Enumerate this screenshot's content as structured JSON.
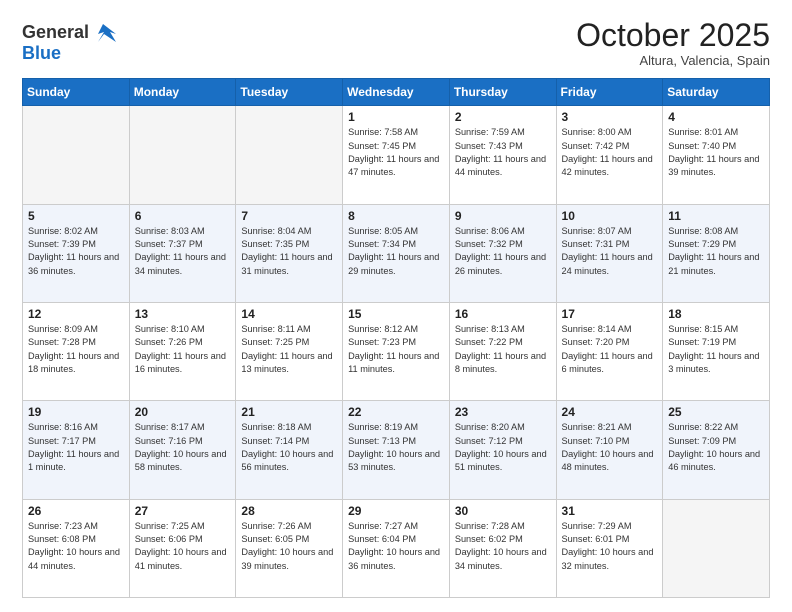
{
  "header": {
    "logo_general": "General",
    "logo_blue": "Blue",
    "month_title": "October 2025",
    "subtitle": "Altura, Valencia, Spain"
  },
  "weekdays": [
    "Sunday",
    "Monday",
    "Tuesday",
    "Wednesday",
    "Thursday",
    "Friday",
    "Saturday"
  ],
  "weeks": [
    [
      {
        "day": "",
        "info": ""
      },
      {
        "day": "",
        "info": ""
      },
      {
        "day": "",
        "info": ""
      },
      {
        "day": "1",
        "info": "Sunrise: 7:58 AM\nSunset: 7:45 PM\nDaylight: 11 hours\nand 47 minutes."
      },
      {
        "day": "2",
        "info": "Sunrise: 7:59 AM\nSunset: 7:43 PM\nDaylight: 11 hours\nand 44 minutes."
      },
      {
        "day": "3",
        "info": "Sunrise: 8:00 AM\nSunset: 7:42 PM\nDaylight: 11 hours\nand 42 minutes."
      },
      {
        "day": "4",
        "info": "Sunrise: 8:01 AM\nSunset: 7:40 PM\nDaylight: 11 hours\nand 39 minutes."
      }
    ],
    [
      {
        "day": "5",
        "info": "Sunrise: 8:02 AM\nSunset: 7:39 PM\nDaylight: 11 hours\nand 36 minutes."
      },
      {
        "day": "6",
        "info": "Sunrise: 8:03 AM\nSunset: 7:37 PM\nDaylight: 11 hours\nand 34 minutes."
      },
      {
        "day": "7",
        "info": "Sunrise: 8:04 AM\nSunset: 7:35 PM\nDaylight: 11 hours\nand 31 minutes."
      },
      {
        "day": "8",
        "info": "Sunrise: 8:05 AM\nSunset: 7:34 PM\nDaylight: 11 hours\nand 29 minutes."
      },
      {
        "day": "9",
        "info": "Sunrise: 8:06 AM\nSunset: 7:32 PM\nDaylight: 11 hours\nand 26 minutes."
      },
      {
        "day": "10",
        "info": "Sunrise: 8:07 AM\nSunset: 7:31 PM\nDaylight: 11 hours\nand 24 minutes."
      },
      {
        "day": "11",
        "info": "Sunrise: 8:08 AM\nSunset: 7:29 PM\nDaylight: 11 hours\nand 21 minutes."
      }
    ],
    [
      {
        "day": "12",
        "info": "Sunrise: 8:09 AM\nSunset: 7:28 PM\nDaylight: 11 hours\nand 18 minutes."
      },
      {
        "day": "13",
        "info": "Sunrise: 8:10 AM\nSunset: 7:26 PM\nDaylight: 11 hours\nand 16 minutes."
      },
      {
        "day": "14",
        "info": "Sunrise: 8:11 AM\nSunset: 7:25 PM\nDaylight: 11 hours\nand 13 minutes."
      },
      {
        "day": "15",
        "info": "Sunrise: 8:12 AM\nSunset: 7:23 PM\nDaylight: 11 hours\nand 11 minutes."
      },
      {
        "day": "16",
        "info": "Sunrise: 8:13 AM\nSunset: 7:22 PM\nDaylight: 11 hours\nand 8 minutes."
      },
      {
        "day": "17",
        "info": "Sunrise: 8:14 AM\nSunset: 7:20 PM\nDaylight: 11 hours\nand 6 minutes."
      },
      {
        "day": "18",
        "info": "Sunrise: 8:15 AM\nSunset: 7:19 PM\nDaylight: 11 hours\nand 3 minutes."
      }
    ],
    [
      {
        "day": "19",
        "info": "Sunrise: 8:16 AM\nSunset: 7:17 PM\nDaylight: 11 hours\nand 1 minute."
      },
      {
        "day": "20",
        "info": "Sunrise: 8:17 AM\nSunset: 7:16 PM\nDaylight: 10 hours\nand 58 minutes."
      },
      {
        "day": "21",
        "info": "Sunrise: 8:18 AM\nSunset: 7:14 PM\nDaylight: 10 hours\nand 56 minutes."
      },
      {
        "day": "22",
        "info": "Sunrise: 8:19 AM\nSunset: 7:13 PM\nDaylight: 10 hours\nand 53 minutes."
      },
      {
        "day": "23",
        "info": "Sunrise: 8:20 AM\nSunset: 7:12 PM\nDaylight: 10 hours\nand 51 minutes."
      },
      {
        "day": "24",
        "info": "Sunrise: 8:21 AM\nSunset: 7:10 PM\nDaylight: 10 hours\nand 48 minutes."
      },
      {
        "day": "25",
        "info": "Sunrise: 8:22 AM\nSunset: 7:09 PM\nDaylight: 10 hours\nand 46 minutes."
      }
    ],
    [
      {
        "day": "26",
        "info": "Sunrise: 7:23 AM\nSunset: 6:08 PM\nDaylight: 10 hours\nand 44 minutes."
      },
      {
        "day": "27",
        "info": "Sunrise: 7:25 AM\nSunset: 6:06 PM\nDaylight: 10 hours\nand 41 minutes."
      },
      {
        "day": "28",
        "info": "Sunrise: 7:26 AM\nSunset: 6:05 PM\nDaylight: 10 hours\nand 39 minutes."
      },
      {
        "day": "29",
        "info": "Sunrise: 7:27 AM\nSunset: 6:04 PM\nDaylight: 10 hours\nand 36 minutes."
      },
      {
        "day": "30",
        "info": "Sunrise: 7:28 AM\nSunset: 6:02 PM\nDaylight: 10 hours\nand 34 minutes."
      },
      {
        "day": "31",
        "info": "Sunrise: 7:29 AM\nSunset: 6:01 PM\nDaylight: 10 hours\nand 32 minutes."
      },
      {
        "day": "",
        "info": ""
      }
    ]
  ]
}
